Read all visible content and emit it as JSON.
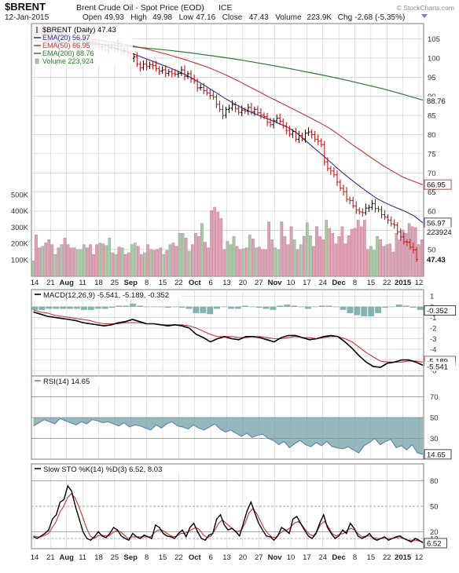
{
  "header": {
    "symbol": "$BRENT",
    "name": "Brent Crude Oil - Spot Price (EOD)",
    "exchange": "ICE",
    "date": "12-Jan-2015",
    "watermark": "© StockCharts.com",
    "quote": [
      {
        "label": "Open",
        "value": "49.93"
      },
      {
        "label": "High",
        "value": "49.98"
      },
      {
        "label": "Low",
        "value": "47.16"
      },
      {
        "label": "Close",
        "value": "47.43"
      },
      {
        "label": "Volume",
        "value": "223.9K"
      },
      {
        "label": "Chg",
        "value": "-2.68 (-5.35%)"
      }
    ]
  },
  "colors": {
    "ema20": "#303090",
    "ema50": "#d03030",
    "ema200": "#2a7a2a",
    "bar": "#000000",
    "down_bar": "#cc0000",
    "vol_up": "#a8c8a8",
    "vol_down": "#e0a0b4",
    "macd": "#000000",
    "signal": "#d03030",
    "hist": "#5a9a9a",
    "rsi": "#6080b0",
    "rsi_fill": "#6a9aa0",
    "sto_k": "#000000",
    "sto_d": "#d03030",
    "grid": "#c8c8c8",
    "tag_red": "#d03030"
  },
  "chart_data": [
    {
      "type": "ohlc",
      "title": "$BRENT (Daily) 47.43",
      "legend": [
        {
          "label": "$BRENT (Daily) 47.43",
          "color": "#000000"
        },
        {
          "label": "EMA(20) 56.97",
          "color": "#303090"
        },
        {
          "label": "EMA(50) 66.95",
          "color": "#d03030"
        },
        {
          "label": "EMA(200) 88.76",
          "color": "#2a7a2a"
        },
        {
          "label": "Volume 223,924",
          "color": "#2a7a2a"
        }
      ],
      "x_labels": [
        "14",
        "21",
        "Aug",
        "11",
        "18",
        "25",
        "Sep",
        "8",
        "15",
        "22",
        "Oct",
        "6",
        "13",
        "20",
        "27",
        "Nov",
        "10",
        "17",
        "24",
        "Dec",
        "8",
        "15",
        "22",
        "2015",
        "12"
      ],
      "x_label_bold": [
        "Aug",
        "Sep",
        "Oct",
        "Nov",
        "Dec",
        "2015"
      ],
      "y_ticks": [
        50,
        55,
        60,
        65,
        70,
        75,
        80,
        85,
        90,
        95,
        100,
        105
      ],
      "ylim": [
        43,
        109
      ],
      "volume_ticks": [
        "100K",
        "200K",
        "300K",
        "400K",
        "500K"
      ],
      "volume_ticks_values": [
        100,
        200,
        300,
        400,
        500
      ],
      "volume_scale_max": 560,
      "right_tags": [
        {
          "text": "88.76",
          "value": 88.76,
          "style": "plain"
        },
        {
          "text": "66.95",
          "value": 66.95,
          "style": "outline-red"
        },
        {
          "text": "56.97",
          "value": 56.97,
          "style": "outline-blue"
        },
        {
          "text": "223924",
          "value": 54.6,
          "style": "plain"
        },
        {
          "text": "47.43",
          "value": 47.43,
          "style": "bold"
        }
      ],
      "series": [
        {
          "name": "$BRENT",
          "close": [
            107.4,
            106.8,
            106.0,
            107.2,
            106.1,
            105.2,
            104.0,
            106.4,
            105.2,
            105.8,
            104.6,
            104.0,
            103.5,
            103.1,
            104.5,
            104.6,
            105.1,
            104.0,
            103.8,
            103.4,
            102.9,
            103.0,
            102.2,
            102.7,
            103.3,
            102.3,
            103.7,
            101.6,
            101.9,
            101.3,
            99.9,
            100.3,
            98.4,
            97.5,
            98.4,
            97.8,
            98.3,
            98.0,
            97.2,
            96.6,
            96.9,
            96.0,
            96.4,
            95.9,
            95.8,
            96.0,
            96.9,
            95.2,
            95.9,
            94.5,
            94.0,
            92.2,
            92.3,
            91.5,
            90.9,
            90.2,
            89.8,
            87.9,
            86.6,
            85.0,
            86.6,
            86.9,
            87.8,
            86.8,
            85.8,
            86.4,
            86.1,
            87.1,
            85.9,
            86.6,
            85.7,
            85.1,
            84.7,
            83.2,
            82.6,
            83.6,
            84.3,
            83.5,
            82.3,
            81.1,
            80.1,
            80.8,
            78.8,
            79.8,
            78.9,
            80.4,
            80.7,
            80.0,
            78.8,
            78.3,
            77.4,
            72.9,
            71.1,
            70.5,
            69.5,
            67.6,
            66.0,
            65.1,
            63.1,
            62.8,
            61.4,
            60.3,
            59.8,
            59.6,
            60.8,
            61.0,
            62.0,
            60.7,
            60.4,
            59.1,
            58.5,
            57.7,
            56.7,
            56.4,
            54.6,
            53.3,
            52.0,
            51.9,
            50.6,
            49.9,
            47.4
          ]
        },
        {
          "name": "EMA(20)",
          "values": [
            106.8,
            106.5,
            106.2,
            106.0,
            105.6,
            105.1,
            104.5,
            103.9,
            103.3,
            102.6,
            101.9,
            101.1,
            100.2,
            99.3,
            98.4,
            97.5,
            96.5,
            95.4,
            94.1,
            92.7,
            91.2,
            89.7,
            88.3,
            87.0,
            85.9,
            84.9,
            84.0,
            83.0,
            82.0,
            80.6,
            78.5,
            76.5,
            74.5,
            72.4,
            70.3,
            68.4,
            66.6,
            64.8,
            63.2,
            62.0,
            61.0,
            60.0,
            58.8,
            57.0
          ]
        },
        {
          "name": "EMA(50)",
          "values": [
            106.2,
            106.1,
            105.9,
            105.7,
            105.4,
            105.1,
            104.8,
            104.4,
            104.0,
            103.5,
            103.0,
            102.4,
            101.7,
            101.0,
            100.2,
            99.4,
            98.5,
            97.6,
            96.5,
            95.3,
            94.0,
            92.6,
            91.2,
            89.8,
            88.5,
            87.1,
            85.8,
            84.4,
            83.0,
            81.5,
            79.6,
            77.6,
            75.8,
            73.9,
            72.1,
            70.5,
            69.0,
            67.9,
            66.9
          ]
        },
        {
          "name": "EMA(200)",
          "values": [
            104.5,
            104.3,
            104.0,
            103.7,
            103.4,
            103.0,
            102.5,
            102.0,
            101.4,
            100.7,
            100.0,
            99.2,
            98.3,
            97.4,
            96.4,
            95.4,
            94.3,
            93.1,
            91.9,
            90.5,
            89.0
          ]
        },
        {
          "name": "Volume",
          "values": [
            95,
            255,
            175,
            185,
            205,
            225,
            195,
            135,
            175,
            195,
            235,
            195,
            175,
            175,
            165,
            165,
            195,
            175,
            195,
            135,
            195,
            205,
            200,
            190,
            235,
            145,
            135,
            180,
            175,
            135,
            145,
            195,
            205,
            185,
            135,
            145,
            195,
            165,
            160,
            165,
            175,
            135,
            160,
            195,
            205,
            185,
            265,
            265,
            235,
            155,
            195,
            265,
            245,
            325,
            210,
            175,
            405,
            425,
            395,
            355,
            165,
            215,
            195,
            245,
            185,
            165,
            170,
            175,
            255,
            230,
            175,
            180,
            165,
            165,
            335,
            225,
            175,
            165,
            335,
            245,
            195,
            305,
            225,
            165,
            195,
            245,
            330,
            250,
            185,
            305,
            245,
            225,
            345,
            295,
            265,
            200,
            245,
            305,
            200,
            250,
            290,
            295,
            345,
            305,
            345,
            165,
            185,
            160,
            245,
            225,
            185,
            195,
            200,
            150,
            265,
            225,
            285,
            265,
            325,
            305,
            300,
            195,
            225
          ]
        }
      ]
    },
    {
      "type": "line",
      "title": "MACD(12,26,9) -5.541, -5.189, -0.352",
      "y_ticks": [
        1,
        0,
        -1,
        -2,
        -3,
        -4,
        -5,
        -6
      ],
      "ylim": [
        -6.5,
        1.6
      ],
      "right_tags": [
        {
          "text": "-0.352",
          "value": -0.35,
          "style": "outline-dark"
        },
        {
          "text": "-5.189",
          "value": -5.09,
          "style": "outline-red"
        },
        {
          "text": "-5.541",
          "value": -5.6,
          "style": "plain"
        }
      ],
      "series": [
        {
          "name": "MACD",
          "values": [
            -0.5,
            -0.7,
            -0.9,
            -1.0,
            -1.1,
            -1.2,
            -1.3,
            -1.5,
            -1.6,
            -1.7,
            -1.8,
            -1.7,
            -1.5,
            -1.4,
            -1.2,
            -1.4,
            -1.6,
            -1.6,
            -1.7,
            -1.8,
            -1.7,
            -1.8,
            -2.0,
            -2.6,
            -2.9,
            -3.3,
            -3.0,
            -2.8,
            -3.0,
            -3.1,
            -2.8,
            -2.8,
            -2.9,
            -3.1,
            -3.3,
            -2.9,
            -2.7,
            -2.7,
            -2.9,
            -3.1,
            -3.0,
            -2.8,
            -2.7,
            -2.8,
            -3.3,
            -3.9,
            -4.6,
            -5.2,
            -5.6,
            -5.7,
            -5.3,
            -5.2,
            -5.0,
            -5.0,
            -5.2,
            -5.5
          ]
        },
        {
          "name": "Signal",
          "values": [
            -0.3,
            -0.5,
            -0.6,
            -0.8,
            -0.9,
            -1.0,
            -1.1,
            -1.2,
            -1.3,
            -1.5,
            -1.6,
            -1.6,
            -1.6,
            -1.5,
            -1.5,
            -1.5,
            -1.6,
            -1.6,
            -1.7,
            -1.7,
            -1.7,
            -1.7,
            -1.8,
            -2.0,
            -2.3,
            -2.6,
            -2.8,
            -2.8,
            -2.8,
            -2.9,
            -2.9,
            -2.8,
            -2.8,
            -2.9,
            -3.0,
            -3.0,
            -2.9,
            -2.8,
            -2.9,
            -2.9,
            -3.0,
            -2.9,
            -2.8,
            -2.8,
            -3.0,
            -3.3,
            -3.8,
            -4.3,
            -4.7,
            -5.1,
            -5.2,
            -5.2,
            -5.2,
            -5.1,
            -5.1,
            -5.2
          ]
        },
        {
          "name": "Histogram",
          "values": [
            -0.3,
            -0.3,
            -0.2,
            -0.2,
            -0.2,
            -0.2,
            -0.2,
            -0.3,
            -0.3,
            -0.2,
            -0.2,
            -0.1,
            0.1,
            0.1,
            0.3,
            0.1,
            0.0,
            0.0,
            0.0,
            -0.1,
            0.0,
            -0.1,
            -0.2,
            -0.6,
            -0.6,
            -0.7,
            -0.2,
            0.0,
            -0.2,
            -0.2,
            0.1,
            0.0,
            -0.1,
            -0.2,
            -0.3,
            0.1,
            0.2,
            0.1,
            0.0,
            -0.2,
            0.0,
            0.1,
            0.1,
            0.0,
            -0.3,
            -0.6,
            -0.8,
            -0.9,
            -0.9,
            -0.6,
            -0.1,
            0.0,
            0.2,
            0.1,
            -0.1,
            -0.3
          ]
        }
      ]
    },
    {
      "type": "line",
      "title": "RSI(14) 14.65",
      "y_ticks": [
        30,
        50,
        70
      ],
      "ylim": [
        10,
        90
      ],
      "right_tags": [
        {
          "text": "14.65",
          "value": 14.65,
          "style": "outline-dark"
        }
      ],
      "series": [
        {
          "name": "RSI(14)",
          "values": [
            42,
            45,
            48,
            46,
            44,
            49,
            47,
            45,
            43,
            46,
            44,
            48,
            47,
            45,
            46,
            44,
            42,
            45,
            41,
            43,
            42,
            40,
            38,
            43,
            40,
            44,
            46,
            42,
            41,
            39,
            43,
            40,
            38,
            41,
            44,
            39,
            36,
            38,
            35,
            32,
            35,
            31,
            33,
            34,
            30,
            28,
            24,
            27,
            21,
            25,
            28,
            24,
            22,
            26,
            23,
            27,
            22,
            21,
            20,
            22,
            19,
            16,
            23,
            26,
            30,
            24,
            27,
            29,
            21,
            23,
            19,
            24,
            16,
            14.65
          ]
        }
      ]
    },
    {
      "type": "line",
      "title": "Slow STO %K(14) %D(3) 6.52, 8.03",
      "y_ticks": [
        12,
        20,
        50,
        80
      ],
      "ylim": [
        0,
        100
      ],
      "right_tags": [
        {
          "text": "6.52",
          "value": 6.52,
          "style": "outline-dark"
        }
      ],
      "series": [
        {
          "name": "%K",
          "values": [
            14,
            12,
            15,
            18,
            22,
            35,
            40,
            55,
            58,
            74,
            68,
            50,
            35,
            20,
            12,
            10,
            14,
            20,
            15,
            13,
            18,
            25,
            22,
            15,
            12,
            10,
            18,
            14,
            12,
            16,
            14,
            12,
            28,
            25,
            18,
            15,
            14,
            12,
            18,
            22,
            14,
            25,
            30,
            20,
            12,
            10,
            16,
            18,
            35,
            40,
            28,
            22,
            24,
            20,
            15,
            30,
            45,
            55,
            42,
            30,
            22,
            15,
            14,
            10,
            15,
            25,
            22,
            18,
            35,
            38,
            30,
            22,
            15,
            12,
            18,
            30,
            40,
            25,
            18,
            12,
            15,
            22,
            18,
            30,
            24,
            15,
            12,
            14,
            18,
            12,
            10,
            12,
            14,
            10,
            12,
            14,
            15,
            12,
            10,
            8,
            12,
            10,
            7
          ]
        },
        {
          "name": "%D",
          "values": [
            15,
            14,
            14,
            16,
            18,
            25,
            32,
            43,
            50,
            60,
            65,
            60,
            50,
            38,
            25,
            15,
            12,
            15,
            16,
            15,
            15,
            19,
            21,
            20,
            16,
            12,
            14,
            14,
            14,
            14,
            14,
            14,
            19,
            22,
            22,
            19,
            16,
            14,
            15,
            18,
            18,
            20,
            23,
            25,
            22,
            16,
            13,
            15,
            22,
            30,
            34,
            30,
            26,
            22,
            20,
            22,
            30,
            42,
            47,
            42,
            33,
            24,
            18,
            14,
            13,
            17,
            21,
            22,
            25,
            30,
            32,
            28,
            22,
            17,
            15,
            20,
            29,
            32,
            26,
            18,
            15,
            17,
            18,
            22,
            24,
            22,
            17,
            14,
            15,
            15,
            13,
            12,
            12,
            12,
            12,
            12,
            13,
            13,
            12,
            10,
            10,
            10,
            9,
            8
          ]
        }
      ]
    }
  ]
}
